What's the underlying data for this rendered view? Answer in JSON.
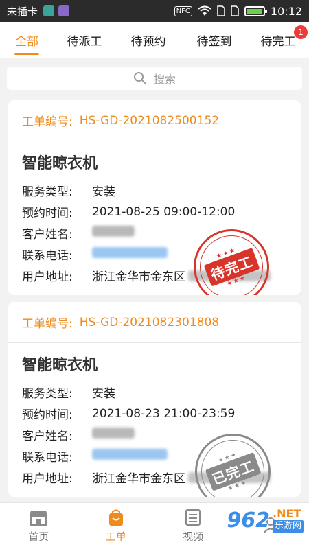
{
  "status_bar": {
    "carrier": "未插卡",
    "nfc": "NFC",
    "time": "10:12"
  },
  "tabs": [
    {
      "label": "全部",
      "active": true
    },
    {
      "label": "待派工",
      "active": false
    },
    {
      "label": "待预约",
      "active": false
    },
    {
      "label": "待签到",
      "active": false
    },
    {
      "label": "待完工",
      "active": false,
      "badge": "1"
    }
  ],
  "search": {
    "label": "搜索"
  },
  "orders": [
    {
      "number_label": "工单编号:",
      "number": "HS-GD-2021082500152",
      "title": "智能晾衣机",
      "fields": [
        {
          "label": "服务类型:",
          "value": "安装"
        },
        {
          "label": "预约时间:",
          "value": "2021-08-25 09:00-12:00"
        },
        {
          "label": "客户姓名:",
          "value": ""
        },
        {
          "label": "联系电话:",
          "value": ""
        },
        {
          "label": "用户地址:",
          "value": "浙江金华市金东区"
        }
      ],
      "stamp": {
        "text": "待完工",
        "color": "#d9342a"
      }
    },
    {
      "number_label": "工单编号:",
      "number": "HS-GD-2021082301808",
      "title": "智能晾衣机",
      "fields": [
        {
          "label": "服务类型:",
          "value": "安装"
        },
        {
          "label": "预约时间:",
          "value": "2021-08-23 21:00-23:59"
        },
        {
          "label": "客户姓名:",
          "value": ""
        },
        {
          "label": "联系电话:",
          "value": ""
        },
        {
          "label": "用户地址:",
          "value": "浙江金华市金东区"
        }
      ],
      "stamp": {
        "text": "已完工",
        "color": "#8a8a8a"
      }
    }
  ],
  "bottom_nav": [
    {
      "label": "首页",
      "icon": "shop-icon",
      "active": false
    },
    {
      "label": "工单",
      "icon": "bag-icon",
      "active": true
    },
    {
      "label": "视频",
      "icon": "video-icon",
      "active": false
    },
    {
      "label": "",
      "icon": "user-icon",
      "active": false
    }
  ],
  "watermark": {
    "number": "962",
    "net": ".NET",
    "cn": "乐游网"
  },
  "colors": {
    "accent": "#f08a1c",
    "badge": "#f03a3a",
    "stamp_red": "#d9342a",
    "stamp_gray": "#8a8a8a"
  }
}
